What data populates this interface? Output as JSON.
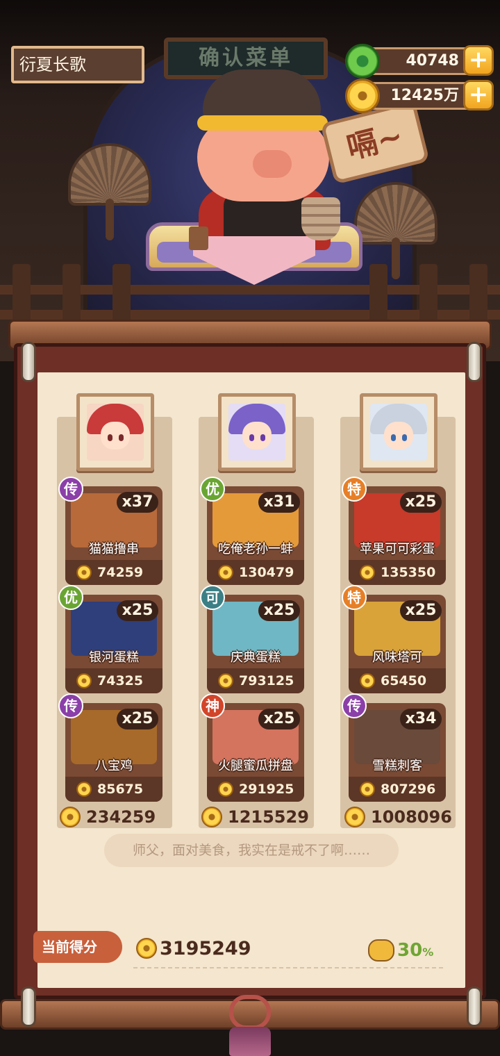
{
  "player": {
    "name": "衍夏长歌"
  },
  "header": {
    "sign_text": "确认菜单"
  },
  "resources": {
    "jade": {
      "icon": "jade-icon",
      "value": "40748"
    },
    "coins": {
      "icon": "coin-icon",
      "value": "12425万"
    },
    "add_label": "+"
  },
  "speech_bubble": "嗝~",
  "columns": [
    {
      "portrait": {
        "icon": "portrait-red-hair-girl",
        "hair": "#c93a3a"
      },
      "dishes": [
        {
          "rank": "传",
          "rank_color": "#8b3fa8",
          "qty": "x37",
          "name": "猫猫撸串",
          "price": "74259",
          "img_color": "#b86a3a"
        },
        {
          "rank": "优",
          "rank_color": "#6aa533",
          "qty": "x25",
          "name": "银河蛋糕",
          "price": "74325",
          "img_color": "#2e3f7c"
        },
        {
          "rank": "传",
          "rank_color": "#8b3fa8",
          "qty": "x25",
          "name": "八宝鸡",
          "price": "85675",
          "img_color": "#a86a2a"
        }
      ],
      "total": "234259"
    },
    {
      "portrait": {
        "icon": "portrait-purple-hair-girl",
        "hair": "#7a62c9"
      },
      "dishes": [
        {
          "rank": "优",
          "rank_color": "#6aa533",
          "qty": "x31",
          "name": "吃俺老孙一蚌",
          "price": "130479",
          "img_color": "#e59a3a"
        },
        {
          "rank": "可",
          "rank_color": "#3c7f84",
          "qty": "x25",
          "name": "庆典蛋糕",
          "price": "793125",
          "img_color": "#6fb7c4"
        },
        {
          "rank": "神",
          "rank_color": "#d2452a",
          "qty": "x25",
          "name": "火腿蜜瓜拼盘",
          "price": "291925",
          "img_color": "#d4735e"
        }
      ],
      "total": "1215529"
    },
    {
      "portrait": {
        "icon": "portrait-silver-hair-boy",
        "hair": "#c9d2de"
      },
      "dishes": [
        {
          "rank": "特",
          "rank_color": "#e67f27",
          "qty": "x25",
          "name": "苹果可可彩蛋",
          "price": "135350",
          "img_color": "#c83a2a"
        },
        {
          "rank": "特",
          "rank_color": "#e67f27",
          "qty": "x25",
          "name": "风味塔可",
          "price": "65450",
          "img_color": "#d9a33a"
        },
        {
          "rank": "传",
          "rank_color": "#8b3fa8",
          "qty": "x34",
          "name": "雪糕刺客",
          "price": "807296",
          "img_color": "#6a4a3a"
        }
      ],
      "total": "1008096"
    }
  ],
  "quote": "师父，面对美食，我实在是戒不了啊……",
  "score": {
    "label": "当前得分",
    "value": "3195249"
  },
  "bonus": {
    "icon": "piggy-bank-icon",
    "value": "30",
    "unit": "%"
  }
}
